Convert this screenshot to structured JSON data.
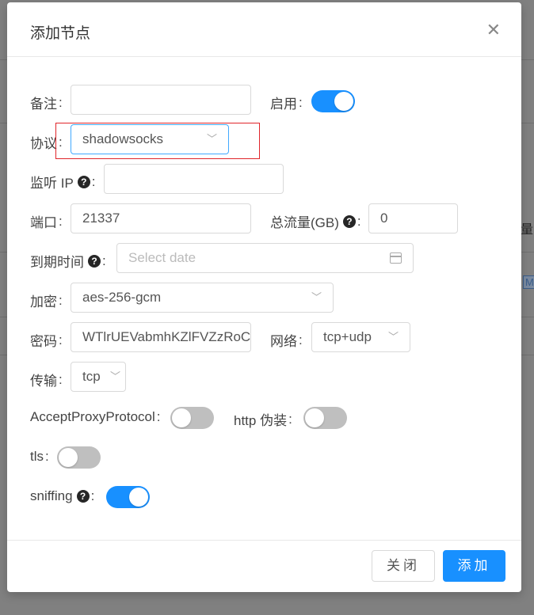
{
  "background": {
    "partial_text_1": "量",
    "partial_tag": "M"
  },
  "modal": {
    "title": "添加节点",
    "close_glyph": "✕"
  },
  "form": {
    "remark": {
      "label": "备注",
      "value": ""
    },
    "enable": {
      "label": "启用",
      "on": true
    },
    "protocol": {
      "label": "协议",
      "value": "shadowsocks"
    },
    "listen_ip": {
      "label": "监听 IP",
      "value": ""
    },
    "port": {
      "label": "端口",
      "value": "21337"
    },
    "total_traffic": {
      "label": "总流量(GB)",
      "value": "0"
    },
    "expiry": {
      "label": "到期时间",
      "placeholder": "Select date"
    },
    "encryption": {
      "label": "加密",
      "value": "aes-256-gcm"
    },
    "password": {
      "label": "密码",
      "value": "WTlrUEVabmhKZlFVZzRoC"
    },
    "network": {
      "label": "网络",
      "value": "tcp+udp"
    },
    "transport": {
      "label": "传输",
      "value": "tcp"
    },
    "accept_proxy_protocol": {
      "label": "AcceptProxyProtocol",
      "on": false
    },
    "http_disguise": {
      "label": "http 伪装",
      "on": false
    },
    "tls": {
      "label": "tls",
      "on": false
    },
    "sniffing": {
      "label": "sniffing",
      "on": true
    }
  },
  "footer": {
    "cancel_label": "关闭",
    "ok_label": "添加"
  },
  "colors": {
    "primary": "#1890ff",
    "highlight": "#e0252a"
  },
  "icons": {
    "help": "question-circle-icon",
    "select_arrow": "chevron-down-icon",
    "calendar": "calendar-icon"
  }
}
